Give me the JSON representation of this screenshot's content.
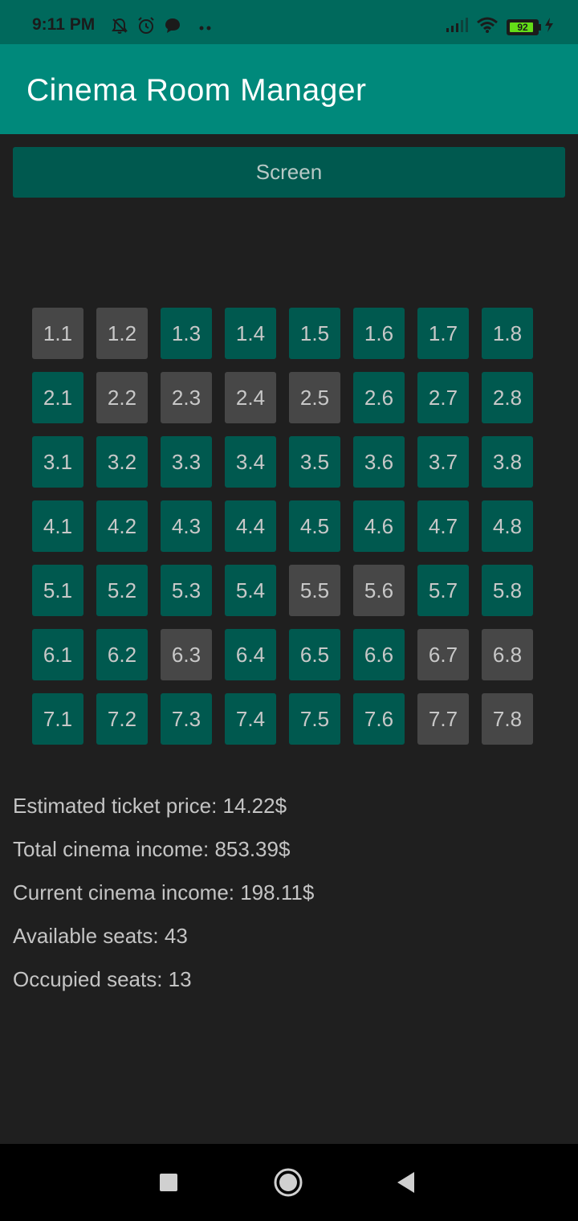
{
  "status_bar": {
    "time": "9:11 PM",
    "battery": "92",
    "battery_level": 0.92
  },
  "app_bar": {
    "title": "Cinema Room Manager"
  },
  "screen": {
    "label": "Screen"
  },
  "seats": [
    [
      {
        "label": "1.1",
        "status": "occupied"
      },
      {
        "label": "1.2",
        "status": "occupied"
      },
      {
        "label": "1.3",
        "status": "available"
      },
      {
        "label": "1.4",
        "status": "available"
      },
      {
        "label": "1.5",
        "status": "available"
      },
      {
        "label": "1.6",
        "status": "available"
      },
      {
        "label": "1.7",
        "status": "available"
      },
      {
        "label": "1.8",
        "status": "available"
      }
    ],
    [
      {
        "label": "2.1",
        "status": "available"
      },
      {
        "label": "2.2",
        "status": "occupied"
      },
      {
        "label": "2.3",
        "status": "occupied"
      },
      {
        "label": "2.4",
        "status": "occupied"
      },
      {
        "label": "2.5",
        "status": "occupied"
      },
      {
        "label": "2.6",
        "status": "available"
      },
      {
        "label": "2.7",
        "status": "available"
      },
      {
        "label": "2.8",
        "status": "available"
      }
    ],
    [
      {
        "label": "3.1",
        "status": "available"
      },
      {
        "label": "3.2",
        "status": "available"
      },
      {
        "label": "3.3",
        "status": "available"
      },
      {
        "label": "3.4",
        "status": "available"
      },
      {
        "label": "3.5",
        "status": "available"
      },
      {
        "label": "3.6",
        "status": "available"
      },
      {
        "label": "3.7",
        "status": "available"
      },
      {
        "label": "3.8",
        "status": "available"
      }
    ],
    [
      {
        "label": "4.1",
        "status": "available"
      },
      {
        "label": "4.2",
        "status": "available"
      },
      {
        "label": "4.3",
        "status": "available"
      },
      {
        "label": "4.4",
        "status": "available"
      },
      {
        "label": "4.5",
        "status": "available"
      },
      {
        "label": "4.6",
        "status": "available"
      },
      {
        "label": "4.7",
        "status": "available"
      },
      {
        "label": "4.8",
        "status": "available"
      }
    ],
    [
      {
        "label": "5.1",
        "status": "available"
      },
      {
        "label": "5.2",
        "status": "available"
      },
      {
        "label": "5.3",
        "status": "available"
      },
      {
        "label": "5.4",
        "status": "available"
      },
      {
        "label": "5.5",
        "status": "occupied"
      },
      {
        "label": "5.6",
        "status": "occupied"
      },
      {
        "label": "5.7",
        "status": "available"
      },
      {
        "label": "5.8",
        "status": "available"
      }
    ],
    [
      {
        "label": "6.1",
        "status": "available"
      },
      {
        "label": "6.2",
        "status": "available"
      },
      {
        "label": "6.3",
        "status": "occupied"
      },
      {
        "label": "6.4",
        "status": "available"
      },
      {
        "label": "6.5",
        "status": "available"
      },
      {
        "label": "6.6",
        "status": "available"
      },
      {
        "label": "6.7",
        "status": "occupied"
      },
      {
        "label": "6.8",
        "status": "occupied"
      }
    ],
    [
      {
        "label": "7.1",
        "status": "available"
      },
      {
        "label": "7.2",
        "status": "available"
      },
      {
        "label": "7.3",
        "status": "available"
      },
      {
        "label": "7.4",
        "status": "available"
      },
      {
        "label": "7.5",
        "status": "available"
      },
      {
        "label": "7.6",
        "status": "available"
      },
      {
        "label": "7.7",
        "status": "occupied"
      },
      {
        "label": "7.8",
        "status": "occupied"
      }
    ]
  ],
  "stats": {
    "ticket_price": "Estimated ticket price: 14.22$",
    "total_income": "Total cinema income: 853.39$",
    "current_income": "Current cinema income: 198.11$",
    "available_seats": "Available seats: 43",
    "occupied_seats": "Occupied seats: 13"
  },
  "colors": {
    "status_bar": "#00695c",
    "app_bar": "#00897b",
    "available_seat": "#00594f",
    "occupied_seat": "#474747",
    "background": "#1f1f1f"
  },
  "icons": {
    "status_left": [
      "bell-off-icon",
      "alarm-icon",
      "message-icon",
      "more-dots-icon"
    ],
    "status_right": [
      "signal-icon",
      "wifi-icon",
      "battery-icon",
      "charging-icon"
    ],
    "nav": [
      "recents-square-icon",
      "home-circle-icon",
      "back-triangle-icon"
    ]
  }
}
